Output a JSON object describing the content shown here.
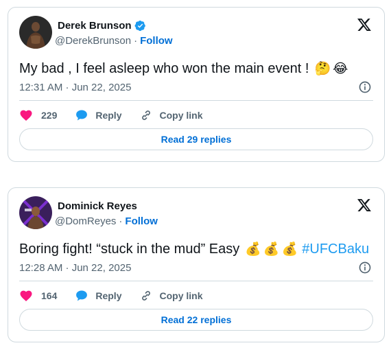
{
  "tweets": [
    {
      "display_name": "Derek Brunson",
      "handle": "@DerekBrunson",
      "separator": "·",
      "follow_label": "Follow",
      "text": "My bad , I feel asleep who won the main event !",
      "emojis": [
        "🤔",
        "😂"
      ],
      "hashtag": "",
      "timestamp": "12:31 AM · Jun 22, 2025",
      "likes": "229",
      "reply_label": "Reply",
      "copy_label": "Copy link",
      "read_replies": "Read 29 replies",
      "verified": true
    },
    {
      "display_name": "Dominick Reyes",
      "handle": "@DomReyes",
      "separator": "·",
      "follow_label": "Follow",
      "text": "Boring fight! “stuck in the mud” Easy",
      "emojis": [
        "💰",
        "💰",
        "💰"
      ],
      "hashtag": "#UFCBaku",
      "timestamp": "12:28 AM · Jun 22, 2025",
      "likes": "164",
      "reply_label": "Reply",
      "copy_label": "Copy link",
      "read_replies": "Read 22 replies",
      "verified": false
    }
  ],
  "colors": {
    "like": "#f91880",
    "reply": "#1d9bf0",
    "link": "#006fd6",
    "muted": "#536471",
    "border": "#cfd9de",
    "verified": "#1d9bf0"
  },
  "icons": [
    "verified-badge-icon",
    "x-logo-icon",
    "info-icon",
    "heart-icon",
    "reply-bubble-icon",
    "link-icon"
  ]
}
